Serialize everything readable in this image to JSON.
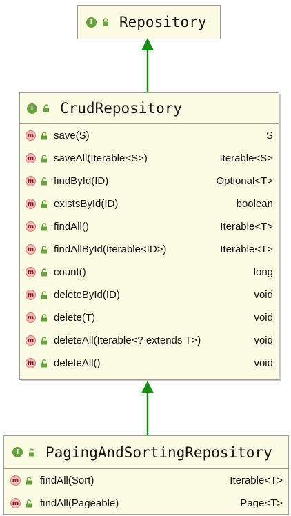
{
  "diagram": {
    "nodes": [
      {
        "id": "repository",
        "badge": "I",
        "title": "Repository",
        "methods": []
      },
      {
        "id": "crud",
        "badge": "I",
        "title": "CrudRepository",
        "method_badge": "m",
        "methods": [
          {
            "signature": "save(S)",
            "returns": "S"
          },
          {
            "signature": "saveAll(Iterable<S>)",
            "returns": "Iterable<S>"
          },
          {
            "signature": "findById(ID)",
            "returns": "Optional<T>"
          },
          {
            "signature": "existsById(ID)",
            "returns": "boolean"
          },
          {
            "signature": "findAll()",
            "returns": "Iterable<T>"
          },
          {
            "signature": "findAllById(Iterable<ID>)",
            "returns": "Iterable<T>"
          },
          {
            "signature": "count()",
            "returns": "long"
          },
          {
            "signature": "deleteById(ID)",
            "returns": "void"
          },
          {
            "signature": "delete(T)",
            "returns": "void"
          },
          {
            "signature": "deleteAll(Iterable<? extends T>)",
            "returns": "void"
          },
          {
            "signature": "deleteAll()",
            "returns": "void"
          }
        ]
      },
      {
        "id": "paging",
        "badge": "I",
        "title": "PagingAndSortingRepository",
        "method_badge": "m",
        "methods": [
          {
            "signature": "findAll(Sort)",
            "returns": "Iterable<T>"
          },
          {
            "signature": "findAll(Pageable)",
            "returns": "Page<T>"
          }
        ]
      }
    ],
    "edges": [
      {
        "from": "crud",
        "to": "repository",
        "kind": "extends"
      },
      {
        "from": "paging",
        "to": "crud",
        "kind": "extends"
      }
    ],
    "colors": {
      "node_fill": "#fcfce4",
      "border": "#9a9a9a",
      "interface_icon": "#6aa23f",
      "method_icon": "#f4b7b7",
      "arrow": "#1a8a1a"
    }
  }
}
